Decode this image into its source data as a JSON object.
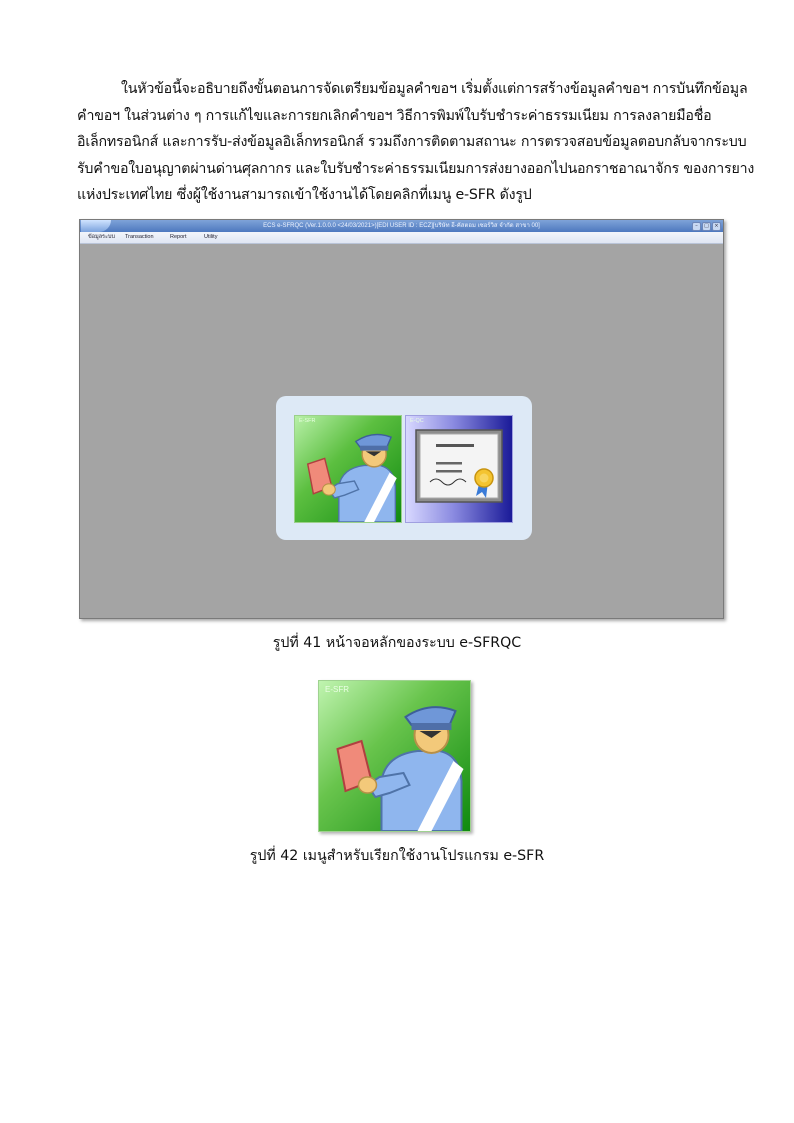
{
  "paragraph": {
    "lines": [
      "ในหัวข้อนี้จะอธิบายถึงขั้นตอนการจัดเตรียมข้อมูลคำขอฯ เริ่มตั้งแต่การสร้างข้อมูลคำขอฯ การบันทึกข้อมูล",
      "คำขอฯ ในส่วนต่าง ๆ การแก้ไขและการยกเลิกคำขอฯ วิธีการพิมพ์ใบรับชำระค่าธรรมเนียม การลงลายมือชื่อ",
      "อิเล็กทรอนิกส์ และการรับ-ส่งข้อมูลอิเล็กทรอนิกส์ รวมถึงการติดตามสถานะ การตรวจสอบข้อมูลตอบกลับจากระบบ",
      "รับคำขอใบอนุญาตผ่านด่านศุลกากร และใบรับชำระค่าธรรมเนียมการส่งยางออกไปนอกราชอาณาจักร ของการยาง",
      "แห่งประเทศไทย ซึ่งผู้ใช้งานสามารถเข้าใช้งานได้โดยคลิกที่เมนู e-SFR ดังรูป"
    ]
  },
  "app_window": {
    "title": "ECS e-SFRQC (Ver.1.0.0.0 <24/03/2021>)[EDI USER ID : ECZ][บริษัท อี-คัสตอม เซอร์วิส จำกัด สาขา 00]",
    "menu": [
      "ข้อมูลระบบ",
      "Transaction",
      "Report",
      "Utility"
    ],
    "window_buttons": [
      "–",
      "□",
      "×"
    ],
    "tiles": [
      {
        "label": "E-SFR",
        "icon": "officer-reading-icon"
      },
      {
        "label": "E-QC",
        "icon": "certificate-icon"
      }
    ],
    "colors": {
      "titlebar": "#5a83c6",
      "workspace": "#a4a4a4",
      "launcher": "#dde9f6",
      "sfr_tile": "#2ea02e",
      "eqc_tile": "#1a1a98"
    }
  },
  "captions": {
    "fig41": "รูปที่ 41 หน้าจอหลักของระบบ e-SFRQC",
    "fig42": "รูปที่ 42 เมนูสำหรับเรียกใช้งานโปรแกรม e-SFR"
  },
  "big_tile": {
    "label": "E-SFR",
    "icon": "officer-reading-icon"
  }
}
